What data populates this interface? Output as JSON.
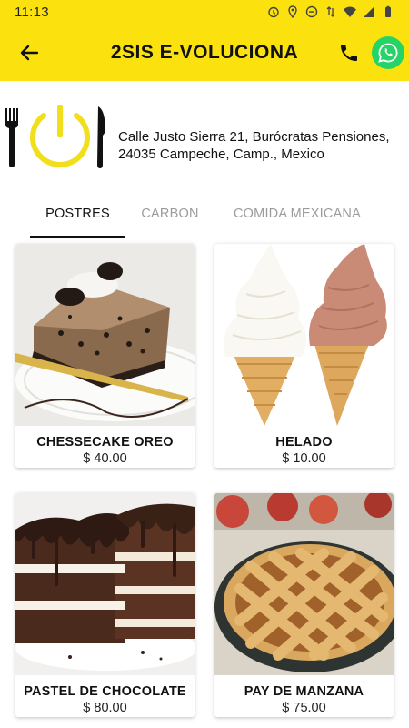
{
  "status_bar": {
    "time": "11:13"
  },
  "header": {
    "title": "2SIS E-VOLUCIONA",
    "accent_color": "#FBE10E",
    "back_icon": "arrow-left-icon",
    "phone_icon": "phone-icon",
    "whatsapp_icon": "whatsapp-icon",
    "whatsapp_color": "#25D366"
  },
  "restaurant": {
    "address_line1": "Calle Justo Sierra 21, Burócratas Pensiones,",
    "address_line2": "24035 Campeche, Camp., Mexico",
    "logo": "fork-power-knife-logo"
  },
  "tabs": [
    {
      "label": "POSTRES",
      "active": true
    },
    {
      "label": "CARBON",
      "active": false
    },
    {
      "label": "COMIDA MEXICANA",
      "active": false
    }
  ],
  "products": [
    {
      "name": "CHESSECAKE OREO",
      "price": "$ 40.00",
      "image": "oreo-cheesecake-image"
    },
    {
      "name": "HELADO",
      "price": "$ 10.00",
      "image": "ice-cream-cones-image"
    },
    {
      "name": "PASTEL DE CHOCOLATE",
      "price": "$ 80.00",
      "image": "chocolate-cake-image"
    },
    {
      "name": "PAY DE MANZANA",
      "price": "$ 75.00",
      "image": "apple-pie-image"
    }
  ]
}
